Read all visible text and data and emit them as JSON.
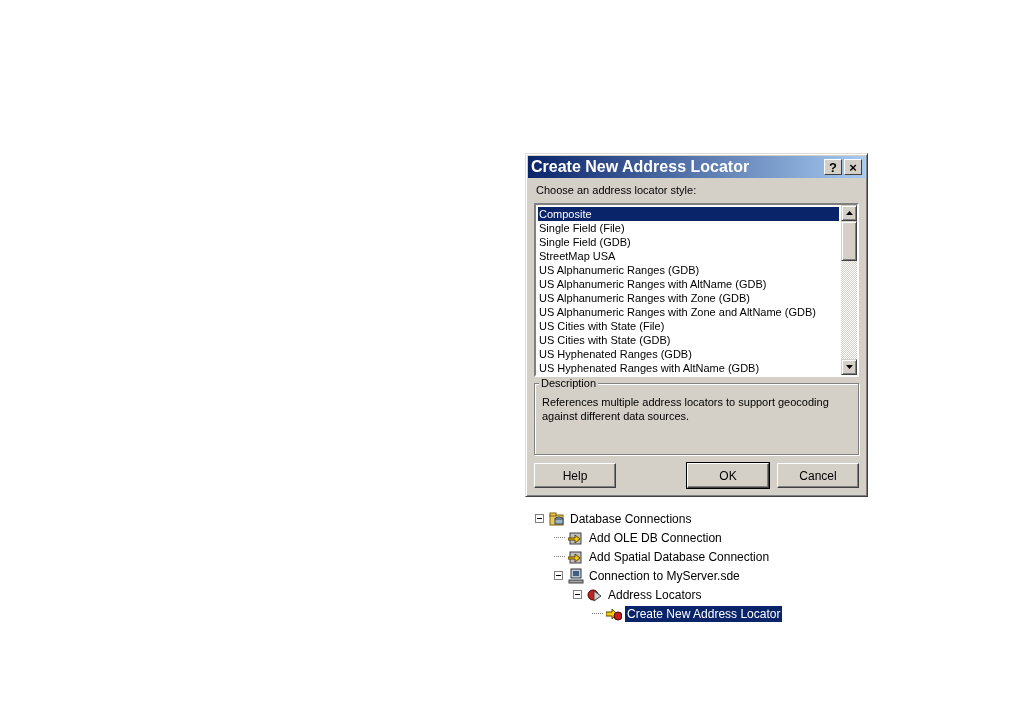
{
  "dialog": {
    "title": "Create New Address Locator",
    "help_button": "?",
    "close_button": "×",
    "prompt": "Choose an address locator style:",
    "styles": [
      {
        "label": "Composite",
        "selected": true
      },
      {
        "label": "Single Field (File)",
        "selected": false
      },
      {
        "label": "Single Field (GDB)",
        "selected": false
      },
      {
        "label": "StreetMap USA",
        "selected": false
      },
      {
        "label": "US Alphanumeric Ranges (GDB)",
        "selected": false
      },
      {
        "label": "US Alphanumeric Ranges with AltName (GDB)",
        "selected": false
      },
      {
        "label": "US Alphanumeric Ranges with Zone (GDB)",
        "selected": false
      },
      {
        "label": "US Alphanumeric Ranges with Zone and AltName (GDB)",
        "selected": false
      },
      {
        "label": "US Cities with State (File)",
        "selected": false
      },
      {
        "label": "US Cities with State (GDB)",
        "selected": false
      },
      {
        "label": "US Hyphenated Ranges (GDB)",
        "selected": false
      },
      {
        "label": "US Hyphenated Ranges with AltName (GDB)",
        "selected": false
      }
    ],
    "description": {
      "title": "Description",
      "text": "References multiple address locators to support geocoding against different data sources."
    },
    "buttons": [
      {
        "label": "Help",
        "default": false
      },
      {
        "label": "OK",
        "default": true
      },
      {
        "label": "Cancel",
        "default": false
      }
    ]
  },
  "tree": [
    {
      "label": "Database Connections",
      "kind": "folder",
      "expanded": true,
      "selected": false,
      "children": [
        {
          "label": "Add OLE DB Connection",
          "kind": "add",
          "selected": false
        },
        {
          "label": "Add Spatial Database Connection",
          "kind": "add",
          "selected": false
        },
        {
          "label": "Connection to MyServer.sde",
          "kind": "server",
          "expanded": true,
          "selected": false,
          "children": [
            {
              "label": "Address Locators",
              "kind": "locators",
              "expanded": true,
              "selected": false,
              "children": [
                {
                  "label": "Create New Address Locator",
                  "kind": "create",
                  "selected": true
                }
              ]
            }
          ]
        }
      ]
    }
  ]
}
